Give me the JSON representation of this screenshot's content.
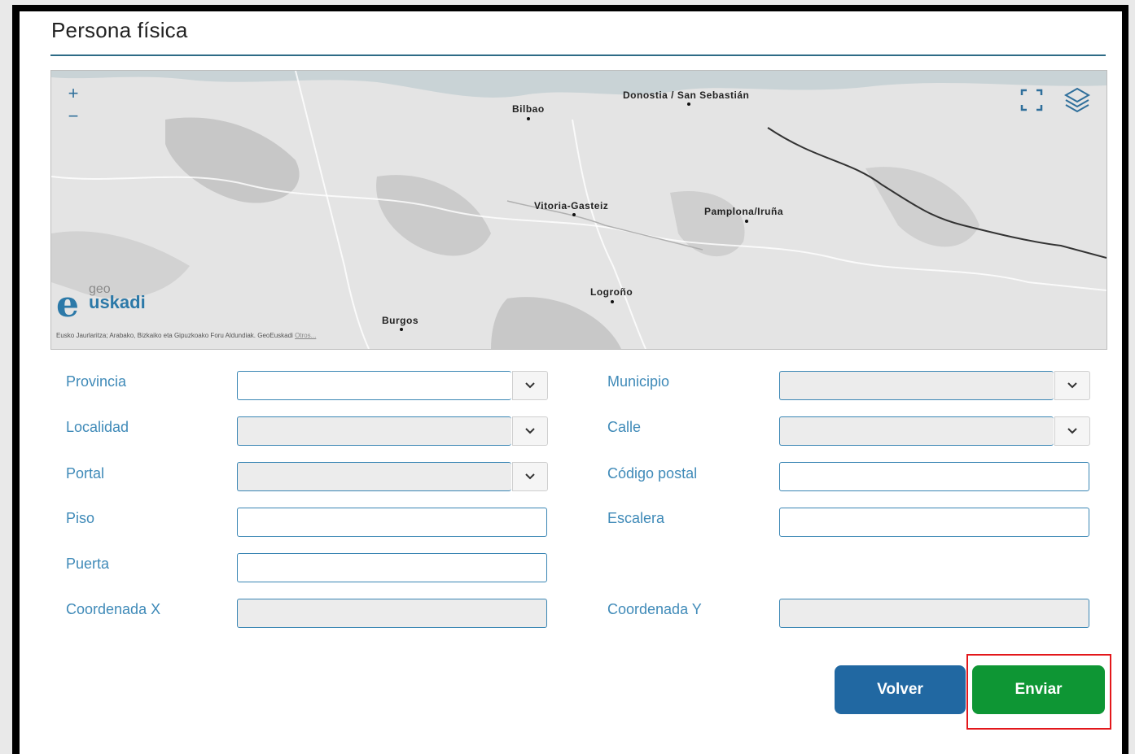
{
  "form": {
    "title": "Persona física"
  },
  "map": {
    "zoom_in": "+",
    "zoom_out": "−",
    "cities": [
      "Bilbao",
      "Donostia / San Sebastián",
      "Vitoria-Gasteiz",
      "Pamplona/Iruña",
      "Logroño",
      "Burgos"
    ],
    "logo_geo": "geo",
    "logo_e": "e",
    "logo_uskadi": "uskadi",
    "attribution": "Eusko Jaurlaritza; Arabako, Bizkaiko eta Gipuzkoako Foru Aldundiak. GeoEuskadi",
    "attribution_more": "Otros...",
    "fullscreen_icon": "fullscreen-icon",
    "layers_icon": "layers-icon"
  },
  "fields": {
    "provincia": {
      "label": "Provincia",
      "value": ""
    },
    "municipio": {
      "label": "Municipio",
      "value": ""
    },
    "localidad": {
      "label": "Localidad",
      "value": ""
    },
    "calle": {
      "label": "Calle",
      "value": ""
    },
    "portal": {
      "label": "Portal",
      "value": ""
    },
    "codigo_postal": {
      "label": "Código postal",
      "value": ""
    },
    "piso": {
      "label": "Piso",
      "value": ""
    },
    "escalera": {
      "label": "Escalera",
      "value": ""
    },
    "puerta": {
      "label": "Puerta",
      "value": ""
    },
    "coord_x": {
      "label": "Coordenada X",
      "value": ""
    },
    "coord_y": {
      "label": "Coordenada Y",
      "value": ""
    }
  },
  "actions": {
    "back_label": "Volver",
    "submit_label": "Enviar"
  },
  "colors": {
    "accent": "#3f8ab8",
    "back_button": "#2168a2",
    "submit_button": "#0e9634",
    "highlight": "#e3171b"
  }
}
